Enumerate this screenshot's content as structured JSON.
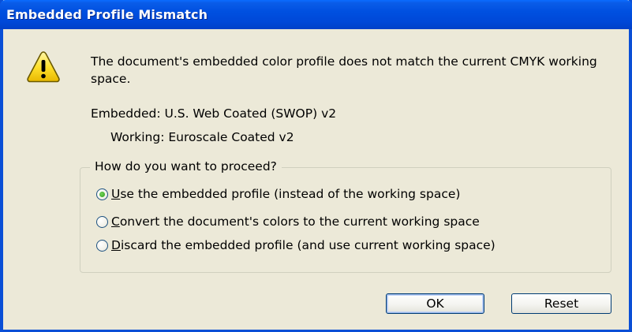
{
  "window": {
    "title": "Embedded Profile Mismatch"
  },
  "icons": {
    "warning": "warning-icon"
  },
  "message": "The document's embedded color profile does not match the current CMYK working space.",
  "embedded": "Embedded: U.S. Web Coated (SWOP) v2",
  "working": "Working: Euroscale Coated v2",
  "group": {
    "legend": "How do you want to proceed?",
    "options": [
      {
        "mnemonic": "U",
        "rest": "se the embedded profile (instead of the working space)",
        "selected": true
      },
      {
        "mnemonic": "C",
        "rest": "onvert the document's colors to the current working space",
        "selected": false
      },
      {
        "mnemonic": "D",
        "rest": "iscard the embedded profile (and use current working space)",
        "selected": false
      }
    ]
  },
  "buttons": {
    "ok": "OK",
    "reset": "Reset"
  },
  "colors": {
    "title_bar": "#0054e3",
    "dialog_bg": "#ece9d8",
    "radio_dot": "#2f9d19"
  }
}
